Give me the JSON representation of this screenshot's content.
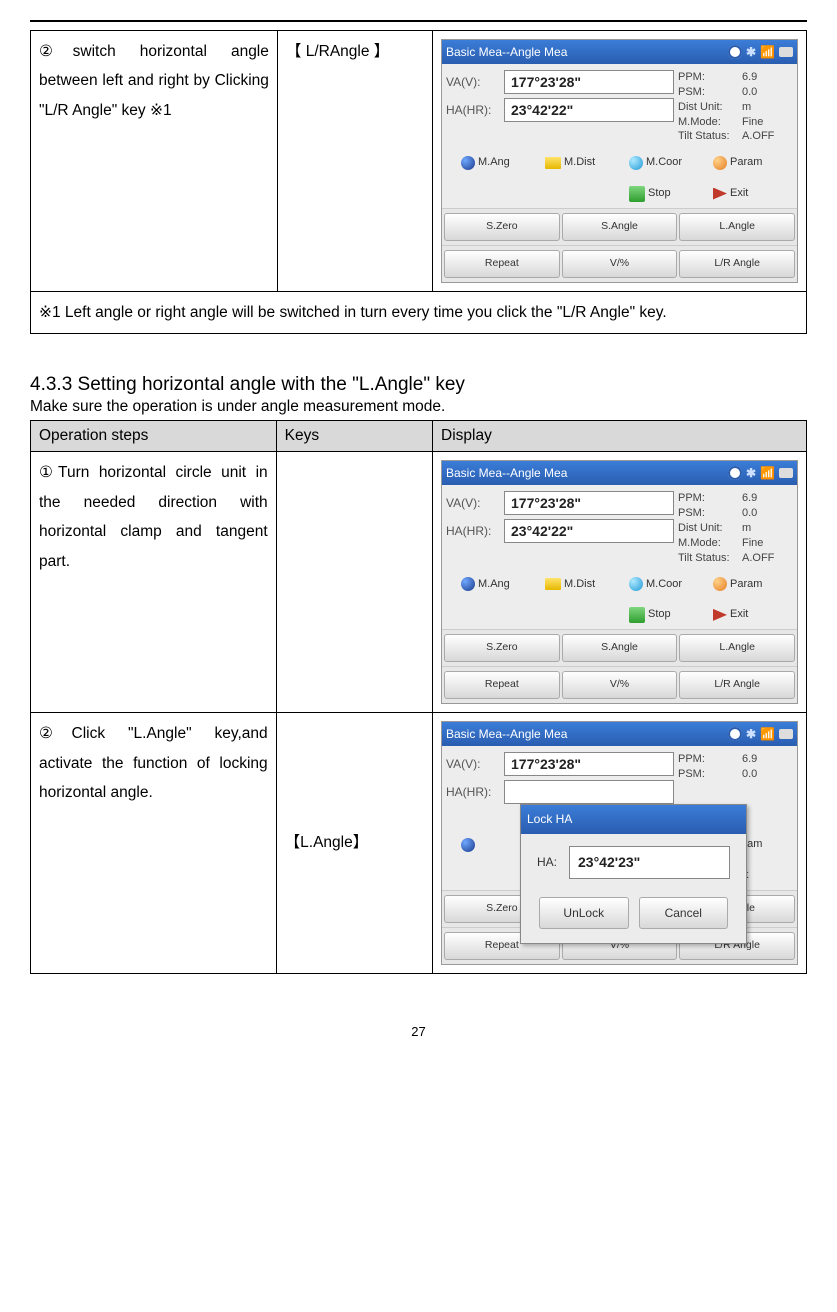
{
  "page_number": "27",
  "section": {
    "title": "4.3.3 Setting horizontal angle with the \"L.Angle\" key",
    "subtitle": "Make sure the operation is under angle measurement mode."
  },
  "table1": {
    "row": {
      "op": "②switch horizontal angle between left and right by Clicking \"L/R Angle\" key    ※1",
      "key": "【 L/RAngle 】"
    },
    "note": "※1 Left angle or right angle will be switched in turn every time you click the \"L/R Angle\" key."
  },
  "table2": {
    "header": {
      "op": "Operation steps",
      "key": "Keys",
      "disp": "Display"
    },
    "row1": {
      "op": "①Turn horizontal circle unit in the needed direction with horizontal clamp and tangent part.",
      "key": ""
    },
    "row2": {
      "op": "②Click \"L.Angle\" key,and activate the function of locking horizontal angle.",
      "key": "【L.Angle】"
    }
  },
  "device": {
    "title": "Basic Mea--Angle Mea",
    "va_label": "VA(V):",
    "ha_label": "HA(HR):",
    "va_value": "177°23'28\"",
    "ha_value": "23°42'22\"",
    "info": {
      "ppm_l": "PPM:",
      "ppm_v": "6.9",
      "psm_l": "PSM:",
      "psm_v": "0.0",
      "dist_l": "Dist Unit:",
      "dist_v": "m",
      "mmode_l": "M.Mode:",
      "mmode_v": "Fine",
      "tilt_l": "Tilt Status:",
      "tilt_v": "A.OFF"
    },
    "mb": {
      "mang": "M.Ang",
      "mdist": "M.Dist",
      "mcoor": "M.Coor",
      "param": "Param",
      "stop": "Stop",
      "exit": "Exit"
    },
    "soft": {
      "szero": "S.Zero",
      "sangle": "S.Angle",
      "langle": "L.Angle",
      "repeat": "Repeat",
      "vpct": "V/%",
      "lrangle": "L/R Angle"
    }
  },
  "dialog": {
    "title": "Lock HA",
    "ha_label": "HA:",
    "ha_value": "23°42'23\"",
    "unlock": "UnLock",
    "cancel": "Cancel"
  }
}
